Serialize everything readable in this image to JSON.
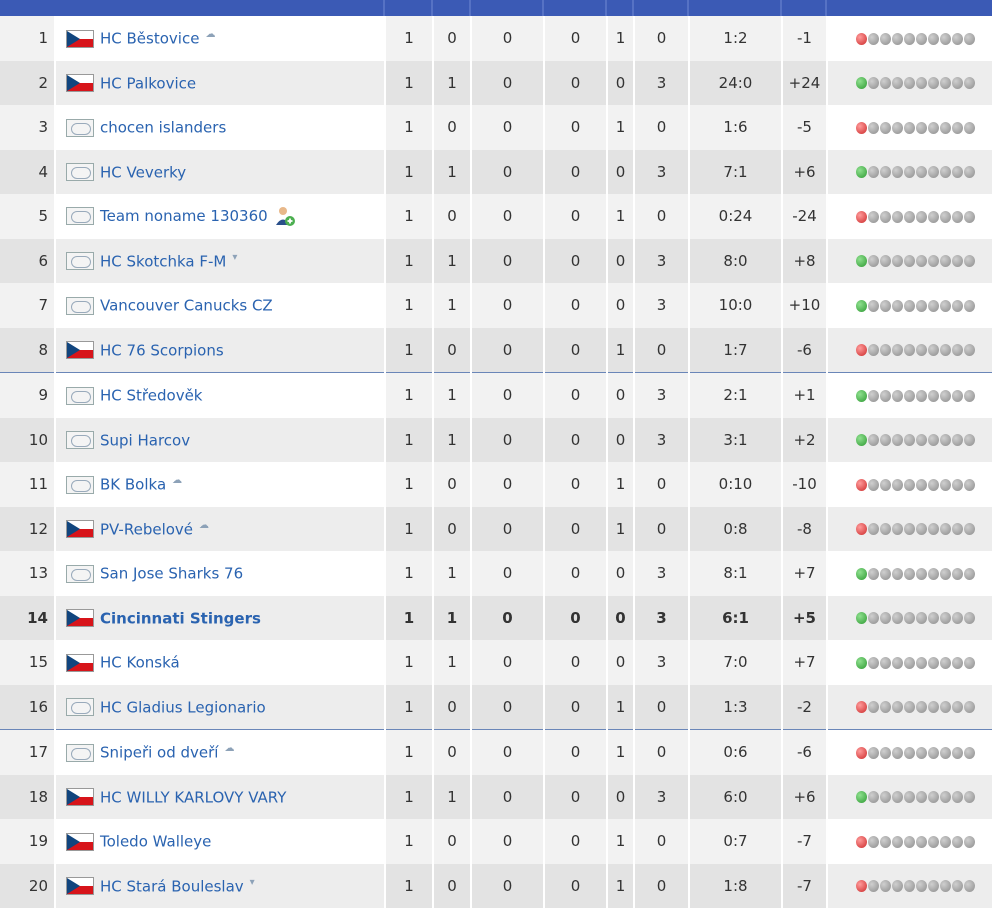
{
  "colors": {
    "header": "#3b5ab5",
    "link": "#2a63b0",
    "win": "#2e9a32",
    "loss": "#cc2a2a",
    "empty": "#8c8c8c"
  },
  "rows": [
    {
      "pos": "1",
      "flag": "cz",
      "team": "HC Běstovice",
      "mark": "up",
      "gp": "1",
      "w": "0",
      "otw": "0",
      "otl": "0",
      "l": "1",
      "pts": "0",
      "score": "1:2",
      "diff": "-1",
      "form": [
        "L",
        "-",
        "-",
        "-",
        "-",
        "-",
        "-",
        "-",
        "-",
        "-"
      ]
    },
    {
      "pos": "2",
      "flag": "cz",
      "team": "HC Palkovice",
      "mark": "",
      "gp": "1",
      "w": "1",
      "otw": "0",
      "otl": "0",
      "l": "0",
      "pts": "3",
      "score": "24:0",
      "diff": "+24",
      "form": [
        "W",
        "-",
        "-",
        "-",
        "-",
        "-",
        "-",
        "-",
        "-",
        "-"
      ]
    },
    {
      "pos": "3",
      "flag": "gen",
      "team": "chocen islanders",
      "mark": "",
      "gp": "1",
      "w": "0",
      "otw": "0",
      "otl": "0",
      "l": "1",
      "pts": "0",
      "score": "1:6",
      "diff": "-5",
      "form": [
        "L",
        "-",
        "-",
        "-",
        "-",
        "-",
        "-",
        "-",
        "-",
        "-"
      ]
    },
    {
      "pos": "4",
      "flag": "gen",
      "team": "HC Veverky",
      "mark": "",
      "gp": "1",
      "w": "1",
      "otw": "0",
      "otl": "0",
      "l": "0",
      "pts": "3",
      "score": "7:1",
      "diff": "+6",
      "form": [
        "W",
        "-",
        "-",
        "-",
        "-",
        "-",
        "-",
        "-",
        "-",
        "-"
      ]
    },
    {
      "pos": "5",
      "flag": "gen",
      "team": "Team noname 130360",
      "mark": "user",
      "gp": "1",
      "w": "0",
      "otw": "0",
      "otl": "0",
      "l": "1",
      "pts": "0",
      "score": "0:24",
      "diff": "-24",
      "form": [
        "L",
        "-",
        "-",
        "-",
        "-",
        "-",
        "-",
        "-",
        "-",
        "-"
      ]
    },
    {
      "pos": "6",
      "flag": "gen",
      "team": "HC Skotchka F-M",
      "mark": "down",
      "gp": "1",
      "w": "1",
      "otw": "0",
      "otl": "0",
      "l": "0",
      "pts": "3",
      "score": "8:0",
      "diff": "+8",
      "form": [
        "W",
        "-",
        "-",
        "-",
        "-",
        "-",
        "-",
        "-",
        "-",
        "-"
      ]
    },
    {
      "pos": "7",
      "flag": "gen",
      "team": "Vancouver Canucks CZ",
      "mark": "",
      "gp": "1",
      "w": "1",
      "otw": "0",
      "otl": "0",
      "l": "0",
      "pts": "3",
      "score": "10:0",
      "diff": "+10",
      "form": [
        "W",
        "-",
        "-",
        "-",
        "-",
        "-",
        "-",
        "-",
        "-",
        "-"
      ]
    },
    {
      "pos": "8",
      "flag": "cz",
      "team": "HC 76 Scorpions",
      "mark": "",
      "gp": "1",
      "w": "0",
      "otw": "0",
      "otl": "0",
      "l": "1",
      "pts": "0",
      "score": "1:7",
      "diff": "-6",
      "form": [
        "L",
        "-",
        "-",
        "-",
        "-",
        "-",
        "-",
        "-",
        "-",
        "-"
      ]
    },
    {
      "pos": "9",
      "flag": "gen",
      "team": "HC Středověk",
      "mark": "",
      "gp": "1",
      "w": "1",
      "otw": "0",
      "otl": "0",
      "l": "0",
      "pts": "3",
      "score": "2:1",
      "diff": "+1",
      "form": [
        "W",
        "-",
        "-",
        "-",
        "-",
        "-",
        "-",
        "-",
        "-",
        "-"
      ]
    },
    {
      "pos": "10",
      "flag": "gen",
      "team": "Supi Harcov",
      "mark": "",
      "gp": "1",
      "w": "1",
      "otw": "0",
      "otl": "0",
      "l": "0",
      "pts": "3",
      "score": "3:1",
      "diff": "+2",
      "form": [
        "W",
        "-",
        "-",
        "-",
        "-",
        "-",
        "-",
        "-",
        "-",
        "-"
      ]
    },
    {
      "pos": "11",
      "flag": "gen",
      "team": "BK Bolka",
      "mark": "up",
      "gp": "1",
      "w": "0",
      "otw": "0",
      "otl": "0",
      "l": "1",
      "pts": "0",
      "score": "0:10",
      "diff": "-10",
      "form": [
        "L",
        "-",
        "-",
        "-",
        "-",
        "-",
        "-",
        "-",
        "-",
        "-"
      ]
    },
    {
      "pos": "12",
      "flag": "cz",
      "team": "PV-Rebelové",
      "mark": "up",
      "gp": "1",
      "w": "0",
      "otw": "0",
      "otl": "0",
      "l": "1",
      "pts": "0",
      "score": "0:8",
      "diff": "-8",
      "form": [
        "L",
        "-",
        "-",
        "-",
        "-",
        "-",
        "-",
        "-",
        "-",
        "-"
      ]
    },
    {
      "pos": "13",
      "flag": "gen",
      "team": "San Jose Sharks 76",
      "mark": "",
      "gp": "1",
      "w": "1",
      "otw": "0",
      "otl": "0",
      "l": "0",
      "pts": "3",
      "score": "8:1",
      "diff": "+7",
      "form": [
        "W",
        "-",
        "-",
        "-",
        "-",
        "-",
        "-",
        "-",
        "-",
        "-"
      ]
    },
    {
      "pos": "14",
      "flag": "cz",
      "team": "Cincinnati Stingers",
      "mark": "",
      "gp": "1",
      "w": "1",
      "otw": "0",
      "otl": "0",
      "l": "0",
      "pts": "3",
      "score": "6:1",
      "diff": "+5",
      "form": [
        "W",
        "-",
        "-",
        "-",
        "-",
        "-",
        "-",
        "-",
        "-",
        "-"
      ]
    },
    {
      "pos": "15",
      "flag": "cz",
      "team": "HC Konská",
      "mark": "",
      "gp": "1",
      "w": "1",
      "otw": "0",
      "otl": "0",
      "l": "0",
      "pts": "3",
      "score": "7:0",
      "diff": "+7",
      "form": [
        "W",
        "-",
        "-",
        "-",
        "-",
        "-",
        "-",
        "-",
        "-",
        "-"
      ]
    },
    {
      "pos": "16",
      "flag": "gen",
      "team": "HC Gladius Legionario",
      "mark": "",
      "gp": "1",
      "w": "0",
      "otw": "0",
      "otl": "0",
      "l": "1",
      "pts": "0",
      "score": "1:3",
      "diff": "-2",
      "form": [
        "L",
        "-",
        "-",
        "-",
        "-",
        "-",
        "-",
        "-",
        "-",
        "-"
      ]
    },
    {
      "pos": "17",
      "flag": "gen",
      "team": "Snipeři od dveří",
      "mark": "up",
      "gp": "1",
      "w": "0",
      "otw": "0",
      "otl": "0",
      "l": "1",
      "pts": "0",
      "score": "0:6",
      "diff": "-6",
      "form": [
        "L",
        "-",
        "-",
        "-",
        "-",
        "-",
        "-",
        "-",
        "-",
        "-"
      ]
    },
    {
      "pos": "18",
      "flag": "cz",
      "team": "HC WILLY KARLOVY VARY",
      "mark": "",
      "gp": "1",
      "w": "1",
      "otw": "0",
      "otl": "0",
      "l": "0",
      "pts": "3",
      "score": "6:0",
      "diff": "+6",
      "form": [
        "W",
        "-",
        "-",
        "-",
        "-",
        "-",
        "-",
        "-",
        "-",
        "-"
      ]
    },
    {
      "pos": "19",
      "flag": "cz",
      "team": "Toledo Walleye",
      "mark": "",
      "gp": "1",
      "w": "0",
      "otw": "0",
      "otl": "0",
      "l": "1",
      "pts": "0",
      "score": "0:7",
      "diff": "-7",
      "form": [
        "L",
        "-",
        "-",
        "-",
        "-",
        "-",
        "-",
        "-",
        "-",
        "-"
      ]
    },
    {
      "pos": "20",
      "flag": "cz",
      "team": "HC Stará Bouleslav",
      "mark": "down",
      "gp": "1",
      "w": "0",
      "otw": "0",
      "otl": "0",
      "l": "1",
      "pts": "0",
      "score": "1:8",
      "diff": "-7",
      "form": [
        "L",
        "-",
        "-",
        "-",
        "-",
        "-",
        "-",
        "-",
        "-",
        "-"
      ]
    }
  ]
}
